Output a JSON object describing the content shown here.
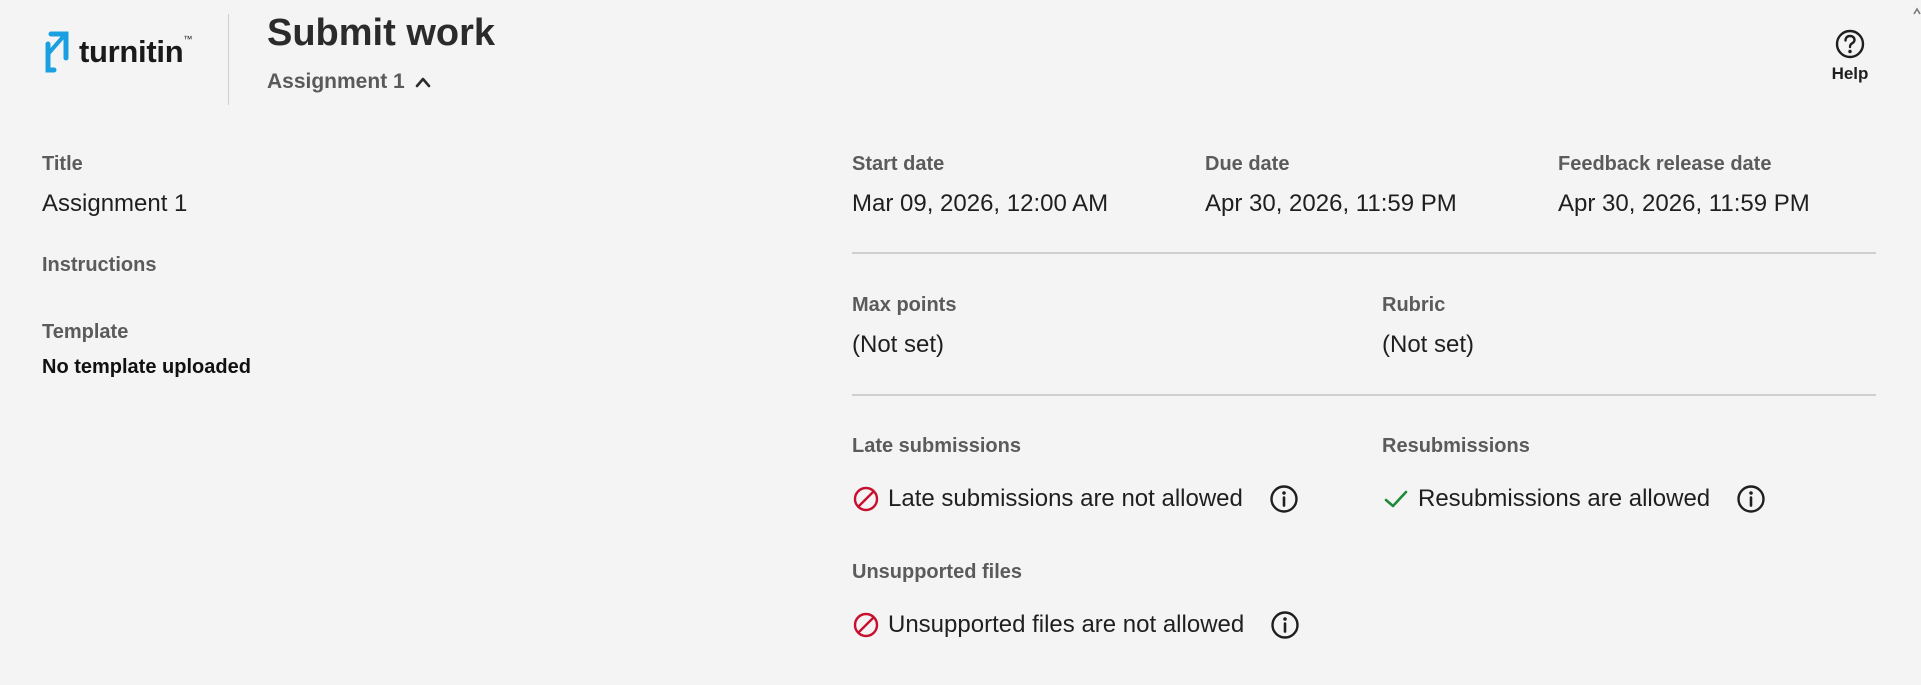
{
  "header": {
    "logo_text": "turnitin",
    "logo_mark": "™",
    "title": "Submit work",
    "assignment_toggle_label": "Assignment 1",
    "help_label": "Help"
  },
  "left": {
    "title_label": "Title",
    "title_value": "Assignment 1",
    "instructions_label": "Instructions",
    "template_label": "Template",
    "template_value": "No template uploaded"
  },
  "dates": {
    "start_label": "Start date",
    "start_value": "Mar 09, 2026, 12:00 AM",
    "due_label": "Due date",
    "due_value": "Apr 30, 2026, 11:59 PM",
    "feedback_label": "Feedback release date",
    "feedback_value": "Apr 30, 2026, 11:59 PM"
  },
  "grading": {
    "max_points_label": "Max points",
    "max_points_value": "(Not set)",
    "rubric_label": "Rubric",
    "rubric_value": "(Not set)"
  },
  "settings": {
    "late_label": "Late submissions",
    "late_status": "Late submissions are not allowed",
    "resub_label": "Resubmissions",
    "resub_status": "Resubmissions are allowed",
    "unsupported_label": "Unsupported files",
    "unsupported_status": "Unsupported files are not allowed"
  },
  "colors": {
    "brand_blue": "#1a9fe0",
    "not_allowed_red": "#c8102e",
    "allowed_green": "#1e8a3a"
  },
  "icons": {
    "logo": "turnitin-logo-icon",
    "toggle": "chevron-up-icon",
    "help": "question-circle-icon",
    "not_allowed": "prohibited-icon",
    "allowed": "checkmark-icon",
    "info": "info-circle-icon"
  }
}
